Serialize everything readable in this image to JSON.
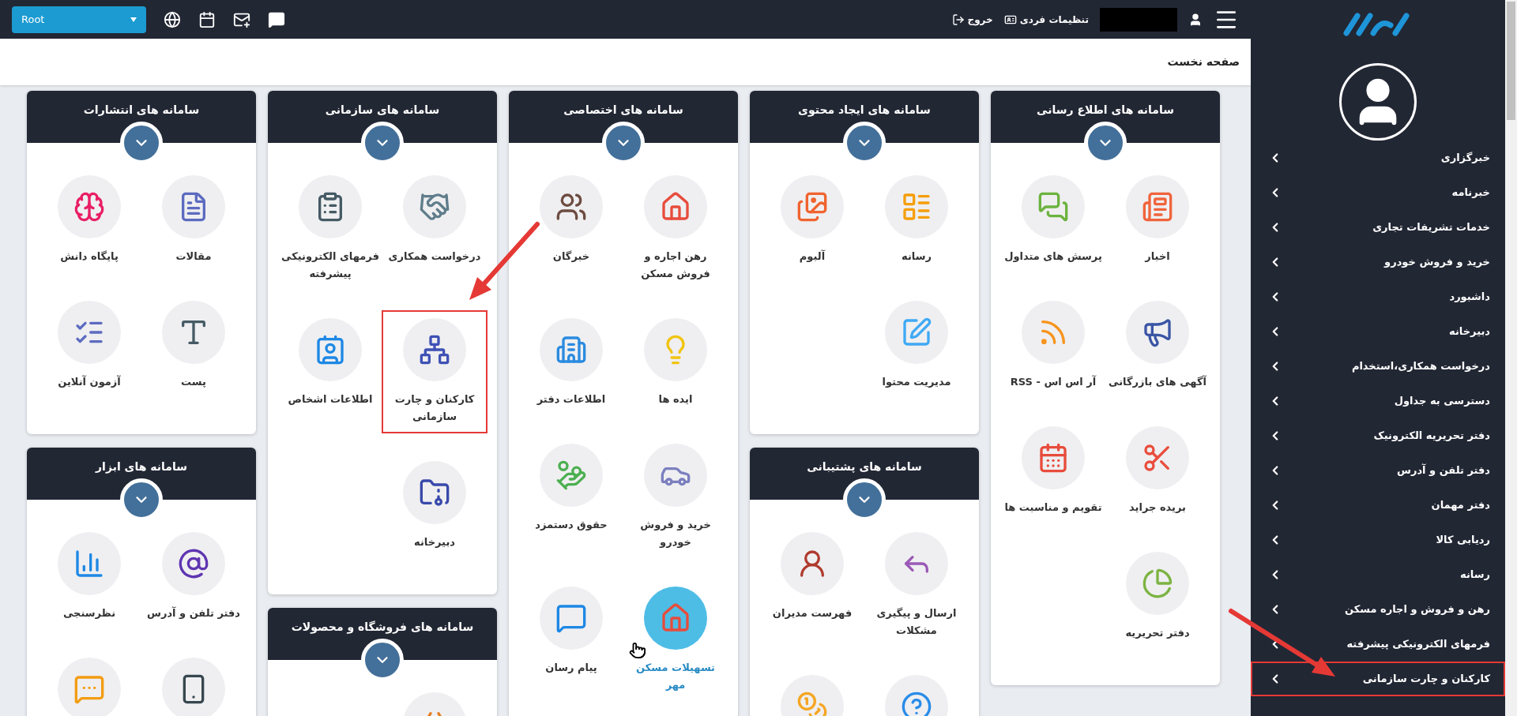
{
  "topbar": {
    "root_select": {
      "value": "Root"
    },
    "settings_link": "تنظیمات فردی",
    "logout_link": "خروج"
  },
  "breadcrumb": "صفحه نخست",
  "columns": [
    {
      "cards": [
        {
          "title": "سامانه های اطلاع رسانی",
          "items": [
            {
              "label": "اخبار",
              "hovered": false,
              "highlighted": false
            },
            {
              "label": "آگهی های بازرگانی",
              "hovered": false,
              "highlighted": false
            },
            {
              "label": "بریده جراید",
              "hovered": false,
              "highlighted": false
            },
            {
              "label": "دفتر تحریریه",
              "hovered": false,
              "highlighted": false
            },
            {
              "label": "پرسش های متداول",
              "hovered": false,
              "highlighted": false
            },
            {
              "label": "آر اس اس - RSS",
              "hovered": false,
              "highlighted": false
            },
            {
              "label": "تقویم و مناسبت ها",
              "hovered": false,
              "highlighted": false
            }
          ]
        }
      ]
    },
    {
      "cards": [
        {
          "title": "سامانه های ایجاد محتوی",
          "items": [
            {
              "label": "رسانه",
              "hovered": false,
              "highlighted": false
            },
            {
              "label": "مدیریت محتوا",
              "hovered": false,
              "highlighted": false
            },
            {
              "label": "آلبوم",
              "hovered": false,
              "highlighted": false
            }
          ]
        },
        {
          "title": "سامانه های پشتیبانی",
          "items": [
            {
              "label": "ارسال و پیگیری مشکلات",
              "hovered": false,
              "highlighted": false
            },
            {
              "hovered": false,
              "highlighted": false
            },
            {
              "label": "فهرست مدیران",
              "hovered": false,
              "highlighted": false
            },
            {
              "hovered": false,
              "highlighted": false
            }
          ]
        }
      ]
    },
    {
      "cards": [
        {
          "title": "سامانه های اختصاصی",
          "items": [
            {
              "label": "رهن اجاره و فروش مسکن",
              "hovered": false,
              "highlighted": false
            },
            {
              "label": "ایده ها",
              "hovered": false,
              "highlighted": false
            },
            {
              "label": "خرید و فروش خودرو",
              "hovered": false,
              "highlighted": false
            },
            {
              "label": "تسهیلات مسکن مهر",
              "hovered": true,
              "highlighted": false
            },
            {
              "label": "خبرگان",
              "hovered": false,
              "highlighted": false
            },
            {
              "label": "اطلاعات دفتر",
              "hovered": false,
              "highlighted": false
            },
            {
              "label": "حقوق دستمزد",
              "hovered": false,
              "highlighted": false
            },
            {
              "label": "پیام رسان",
              "hovered": false,
              "highlighted": false
            }
          ]
        }
      ]
    },
    {
      "cards": [
        {
          "title": "سامانه های سازمانی",
          "items": [
            {
              "label": "درخواست همکاری",
              "hovered": false,
              "highlighted": false
            },
            {
              "label": "کارکنان و چارت سازمانی",
              "hovered": false,
              "highlighted": true
            },
            {
              "label": "دبیرخانه",
              "hovered": false,
              "highlighted": false
            },
            {
              "label": "فرمهای الکترونیکی پیشرفته",
              "hovered": false,
              "highlighted": false
            },
            {
              "label": "اطلاعات اشخاص",
              "hovered": false,
              "highlighted": false
            }
          ]
        },
        {
          "title": "سامانه های فروشگاه و محصولات",
          "items": [
            {
              "hovered": false,
              "highlighted": false
            }
          ]
        }
      ]
    },
    {
      "cards": [
        {
          "title": "سامانه های انتشارات",
          "items": [
            {
              "label": "مقالات",
              "hovered": false,
              "highlighted": false
            },
            {
              "label": "پست",
              "hovered": false,
              "highlighted": false
            },
            {
              "label": "پایگاه دانش",
              "hovered": false,
              "highlighted": false
            },
            {
              "label": "آزمون آنلاین",
              "hovered": false,
              "highlighted": false
            }
          ]
        },
        {
          "title": "سامانه های ابزار",
          "items": [
            {
              "label": "دفتر تلفن و آدرس",
              "hovered": false,
              "highlighted": false
            },
            {
              "hovered": false,
              "highlighted": false
            },
            {
              "label": "نظرسنجی",
              "hovered": false,
              "highlighted": false
            },
            {
              "hovered": false,
              "highlighted": false
            }
          ]
        }
      ]
    }
  ],
  "sidebar": {
    "items": [
      {
        "label": "خبرگزاری",
        "highlighted": false
      },
      {
        "label": "خبرنامه",
        "highlighted": false
      },
      {
        "label": "خدمات تشریفات تجاری",
        "highlighted": false
      },
      {
        "label": "خرید و فروش خودرو",
        "highlighted": false
      },
      {
        "label": "داشبورد",
        "highlighted": false
      },
      {
        "label": "دبیرخانه",
        "highlighted": false
      },
      {
        "label": "درخواست همکاری،استخدام",
        "highlighted": false
      },
      {
        "label": "دسترسی به جداول",
        "highlighted": false
      },
      {
        "label": "دفتر تحریریه الکترونیک",
        "highlighted": false
      },
      {
        "label": "دفتر تلفن و آدرس",
        "highlighted": false
      },
      {
        "label": "دفتر مهمان",
        "highlighted": false
      },
      {
        "label": "ردیابی کالا",
        "highlighted": false
      },
      {
        "label": "رسانه",
        "highlighted": false
      },
      {
        "label": "رهن و فروش و اجاره مسکن",
        "highlighted": false
      },
      {
        "label": "فرمهای الکترونیکی پیشرفته",
        "highlighted": false
      },
      {
        "label": "کارکنان و چارت سازمانی",
        "highlighted": true
      }
    ]
  }
}
